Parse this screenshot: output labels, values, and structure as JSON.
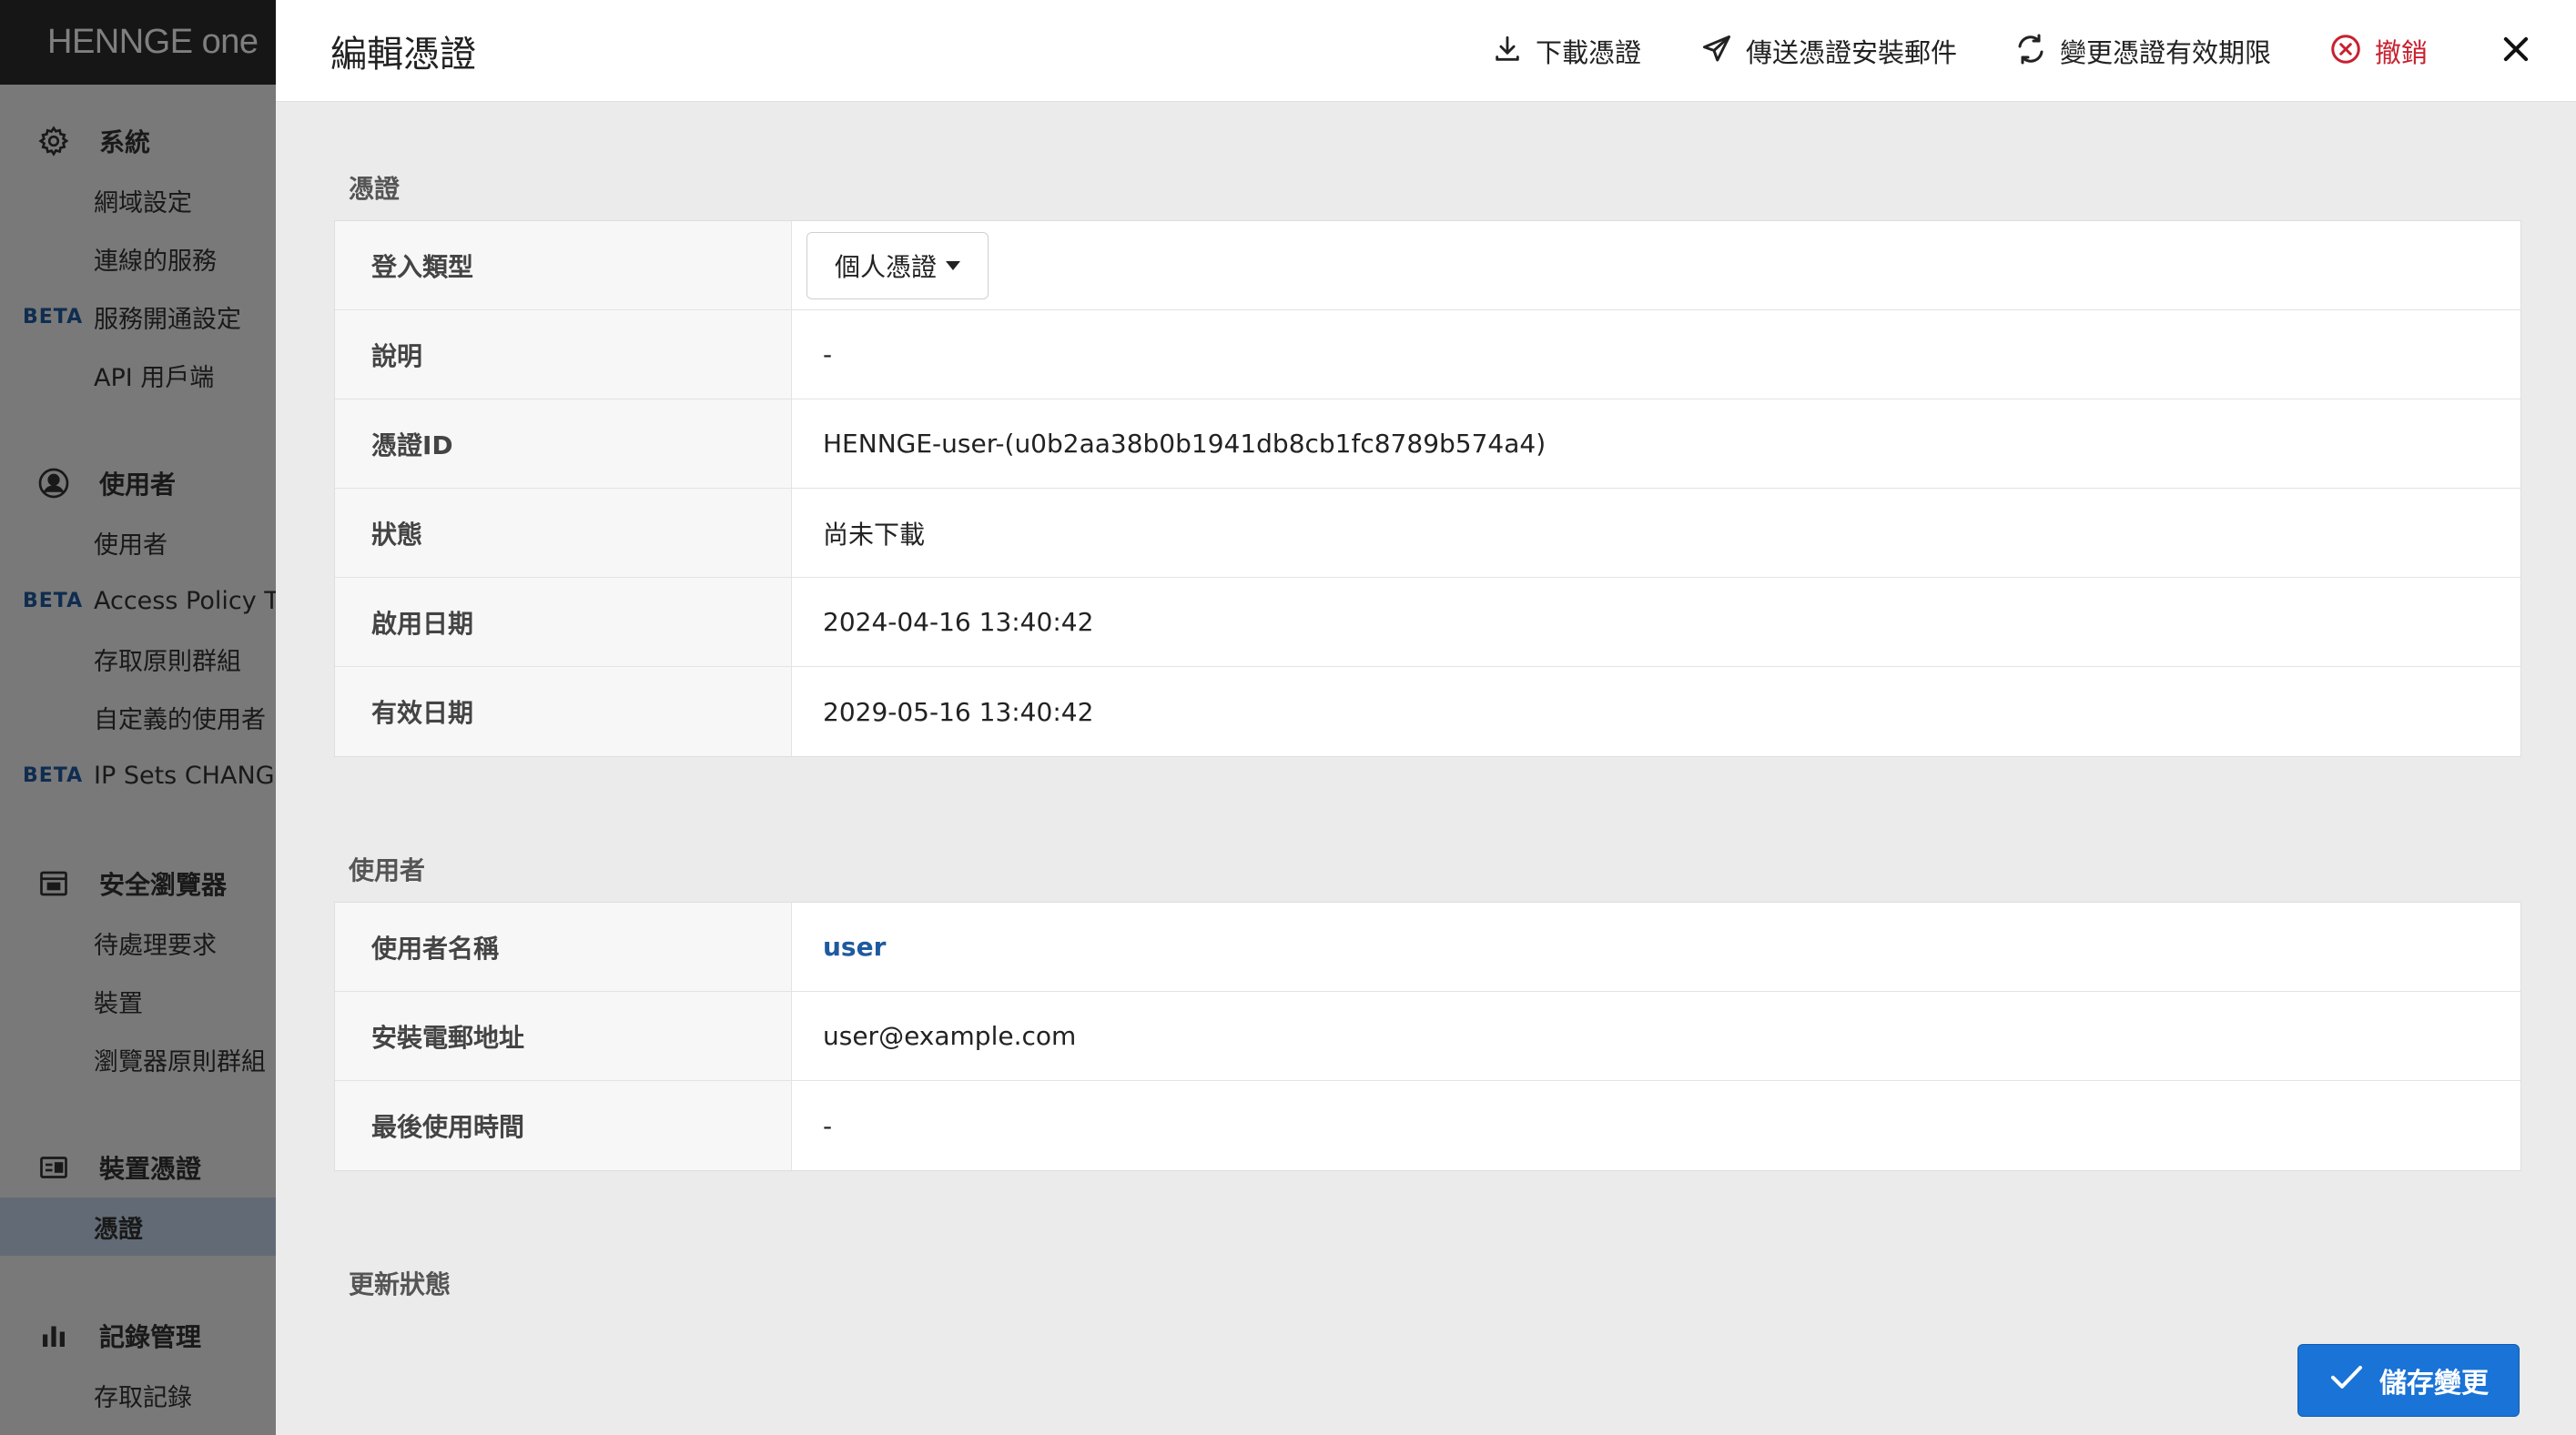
{
  "sidebar": {
    "logo": "HENNGE one",
    "groups": [
      {
        "label": "系統",
        "icon": "gear-icon",
        "items": [
          {
            "label": "網域設定",
            "beta": ""
          },
          {
            "label": "連線的服務",
            "beta": ""
          },
          {
            "label": "服務開通設定",
            "beta": "BETA"
          },
          {
            "label": "API 用戶端",
            "beta": ""
          }
        ]
      },
      {
        "label": "使用者",
        "icon": "user-circle-icon",
        "items": [
          {
            "label": "使用者",
            "beta": ""
          },
          {
            "label": "Access Policy Te",
            "beta": "BETA"
          },
          {
            "label": "存取原則群組",
            "beta": ""
          },
          {
            "label": "自定義的使用者",
            "beta": ""
          },
          {
            "label": "IP Sets CHANGE",
            "beta": "BETA"
          }
        ]
      },
      {
        "label": "安全瀏覽器",
        "icon": "browser-window-icon",
        "items": [
          {
            "label": "待處理要求",
            "beta": ""
          },
          {
            "label": "裝置",
            "beta": ""
          },
          {
            "label": "瀏覽器原則群組",
            "beta": ""
          }
        ]
      },
      {
        "label": "裝置憑證",
        "icon": "id-card-icon",
        "items": [
          {
            "label": "憑證",
            "beta": ""
          }
        ]
      },
      {
        "label": "記錄管理",
        "icon": "bar-chart-icon",
        "items": [
          {
            "label": "存取記錄",
            "beta": ""
          }
        ]
      }
    ]
  },
  "panel": {
    "title": "編輯憑證",
    "actions": {
      "download": "下載憑證",
      "send_mail": "傳送憑證安裝郵件",
      "change_validity": "變更憑證有效期限",
      "revoke": "撤銷"
    },
    "sections": {
      "certificate": {
        "title": "憑證",
        "login_type_label": "登入類型",
        "login_type_value": "個人憑證",
        "description_label": "說明",
        "description_value": "-",
        "id_label": "憑證ID",
        "id_value": "HENNGE-user-(u0b2aa38b0b1941db8cb1fc8789b574a4)",
        "status_label": "狀態",
        "status_value": "尚未下載",
        "start_label": "啟用日期",
        "start_value": "2024-04-16 13:40:42",
        "expiry_label": "有效日期",
        "expiry_value": "2029-05-16 13:40:42"
      },
      "user": {
        "title": "使用者",
        "name_label": "使用者名稱",
        "name_value": "user",
        "email_label": "安裝電郵地址",
        "email_value": "user@example.com",
        "last_used_label": "最後使用時間",
        "last_used_value": "-"
      },
      "update_status": {
        "title": "更新狀態"
      }
    },
    "save_label": "儲存變更"
  },
  "colors": {
    "accent": "#1a73d6",
    "link": "#1e5aa0",
    "danger": "#c8202f",
    "sidebar_active": "#c4d6ea"
  }
}
